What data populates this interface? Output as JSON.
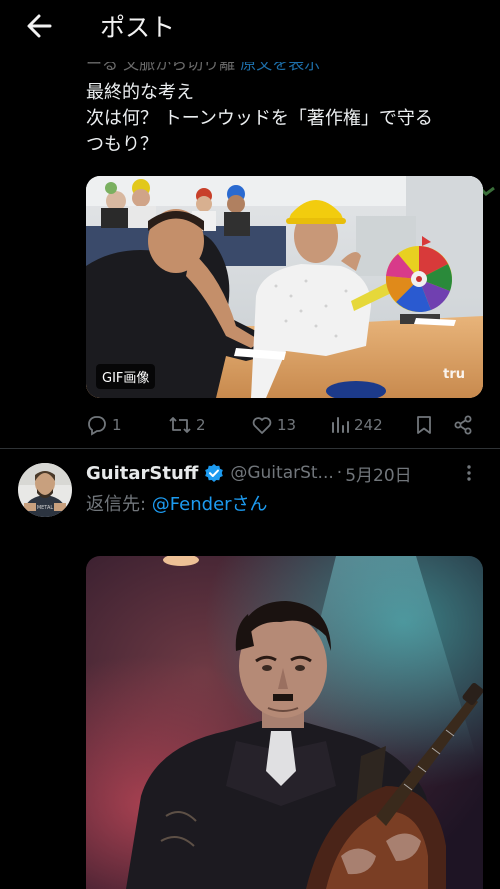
{
  "header": {
    "title": "ポスト"
  },
  "prev_tweet": {
    "truncated_prefix": "ーる 文脈から切り離 ",
    "truncated_link": "原文を表示",
    "text_lines": [
      "最終的な考え",
      "次は何？ トーンウッドを「著作権」で守る",
      "つもり？"
    ],
    "media_badge": "GIF画像",
    "media_watermark": "tru",
    "actions": {
      "replies": "1",
      "reposts": "2",
      "likes": "13",
      "views": "242"
    }
  },
  "tweet": {
    "author_name": "GuitarStuff",
    "handle": "@GuitarSt...",
    "separator": "·",
    "date": "5月20日",
    "more": "⋮",
    "reply_prefix": "返信先: ",
    "reply_mention": "@Fenderさん"
  },
  "colors": {
    "background": "#000000",
    "link": "#1d9bf0",
    "muted": "#71767b",
    "verified": "#1d9bf0"
  },
  "icons": [
    "back-arrow-icon",
    "reply-icon",
    "repost-icon",
    "like-icon",
    "views-icon",
    "bookmark-icon",
    "share-icon",
    "verified-badge-icon",
    "more-icon"
  ]
}
